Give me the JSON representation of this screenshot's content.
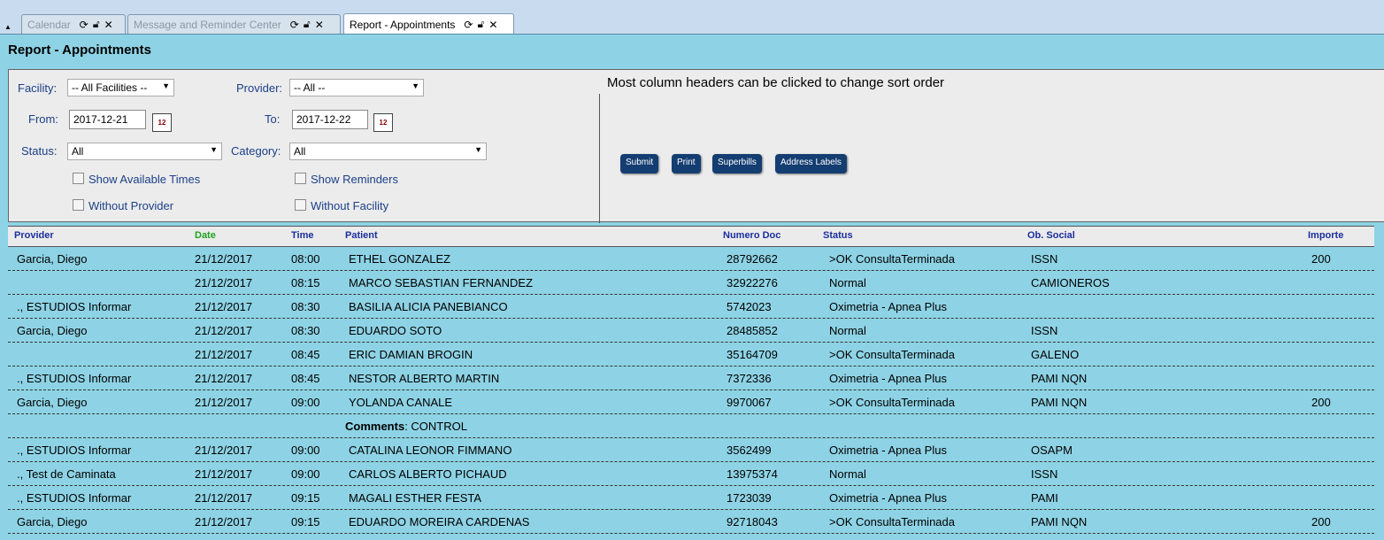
{
  "tabs": [
    {
      "label": "Calendar",
      "active": false
    },
    {
      "label": "Message and Reminder Center",
      "active": false
    },
    {
      "label": "Report - Appointments",
      "active": true
    }
  ],
  "page_title": "Report - Appointments",
  "filters": {
    "facility_label": "Facility:",
    "facility_value": "-- All Facilities --",
    "provider_label": "Provider:",
    "provider_value": "-- All --",
    "from_label": "From:",
    "from_value": "2017-12-21",
    "to_label": "To:",
    "to_value": "2017-12-22",
    "status_label": "Status:",
    "status_value": "All",
    "category_label": "Category:",
    "category_value": "All",
    "show_available_times": "Show Available Times",
    "show_reminders": "Show Reminders",
    "without_provider": "Without Provider",
    "without_facility": "Without Facility",
    "cal_icon_text": "12"
  },
  "note": "Most column headers can be clicked to change sort order",
  "buttons": {
    "submit": "Submit",
    "print": "Print",
    "superbills": "Superbills",
    "address_labels": "Address Labels"
  },
  "columns": {
    "provider": "Provider",
    "date": "Date",
    "time": "Time",
    "patient": "Patient",
    "numero_doc": "Numero Doc",
    "status": "Status",
    "ob_social": "Ob. Social",
    "importe": "Importe"
  },
  "rows": [
    {
      "provider": "Garcia, Diego",
      "date": "21/12/2017",
      "time": "08:00",
      "patient": "ETHEL GONZALEZ",
      "doc": "28792662",
      "status": ">OK ConsultaTerminada",
      "social": "ISSN",
      "importe": "200"
    },
    {
      "provider": "",
      "date": "21/12/2017",
      "time": "08:15",
      "patient": "MARCO SEBASTIAN FERNANDEZ",
      "doc": "32922276",
      "status": "Normal",
      "social": "CAMIONEROS",
      "importe": ""
    },
    {
      "provider": "., ESTUDIOS Informar",
      "date": "21/12/2017",
      "time": "08:30",
      "patient": "BASILIA ALICIA PANEBIANCO",
      "doc": "5742023",
      "status": "Oximetria - Apnea Plus",
      "social": "",
      "importe": ""
    },
    {
      "provider": "Garcia, Diego",
      "date": "21/12/2017",
      "time": "08:30",
      "patient": "EDUARDO SOTO",
      "doc": "28485852",
      "status": "Normal",
      "social": "ISSN",
      "importe": ""
    },
    {
      "provider": "",
      "date": "21/12/2017",
      "time": "08:45",
      "patient": "ERIC DAMIAN BROGIN",
      "doc": "35164709",
      "status": ">OK ConsultaTerminada",
      "social": "GALENO",
      "importe": ""
    },
    {
      "provider": "., ESTUDIOS Informar",
      "date": "21/12/2017",
      "time": "08:45",
      "patient": "NESTOR ALBERTO MARTIN",
      "doc": "7372336",
      "status": "Oximetria - Apnea Plus",
      "social": "PAMI NQN",
      "importe": ""
    },
    {
      "provider": "Garcia, Diego",
      "date": "21/12/2017",
      "time": "09:00",
      "patient": "YOLANDA CANALE",
      "doc": "9970067",
      "status": ">OK ConsultaTerminada",
      "social": "PAMI NQN",
      "importe": "200"
    },
    {
      "comment_label": "Comments",
      "comment_text": ": CONTROL"
    },
    {
      "provider": "., ESTUDIOS Informar",
      "date": "21/12/2017",
      "time": "09:00",
      "patient": "CATALINA LEONOR FIMMANO",
      "doc": "3562499",
      "status": "Oximetria - Apnea Plus",
      "social": "OSAPM",
      "importe": ""
    },
    {
      "provider": "., Test de Caminata",
      "date": "21/12/2017",
      "time": "09:00",
      "patient": "CARLOS ALBERTO PICHAUD",
      "doc": "13975374",
      "status": "Normal",
      "social": "ISSN",
      "importe": ""
    },
    {
      "provider": "., ESTUDIOS Informar",
      "date": "21/12/2017",
      "time": "09:15",
      "patient": "MAGALI ESTHER FESTA",
      "doc": "1723039",
      "status": "Oximetria - Apnea Plus",
      "social": "PAMI",
      "importe": ""
    },
    {
      "provider": "Garcia, Diego",
      "date": "21/12/2017",
      "time": "09:15",
      "patient": "EDUARDO MOREIRA CARDENAS",
      "doc": "92718043",
      "status": ">OK ConsultaTerminada",
      "social": "PAMI NQN",
      "importe": "200"
    }
  ]
}
